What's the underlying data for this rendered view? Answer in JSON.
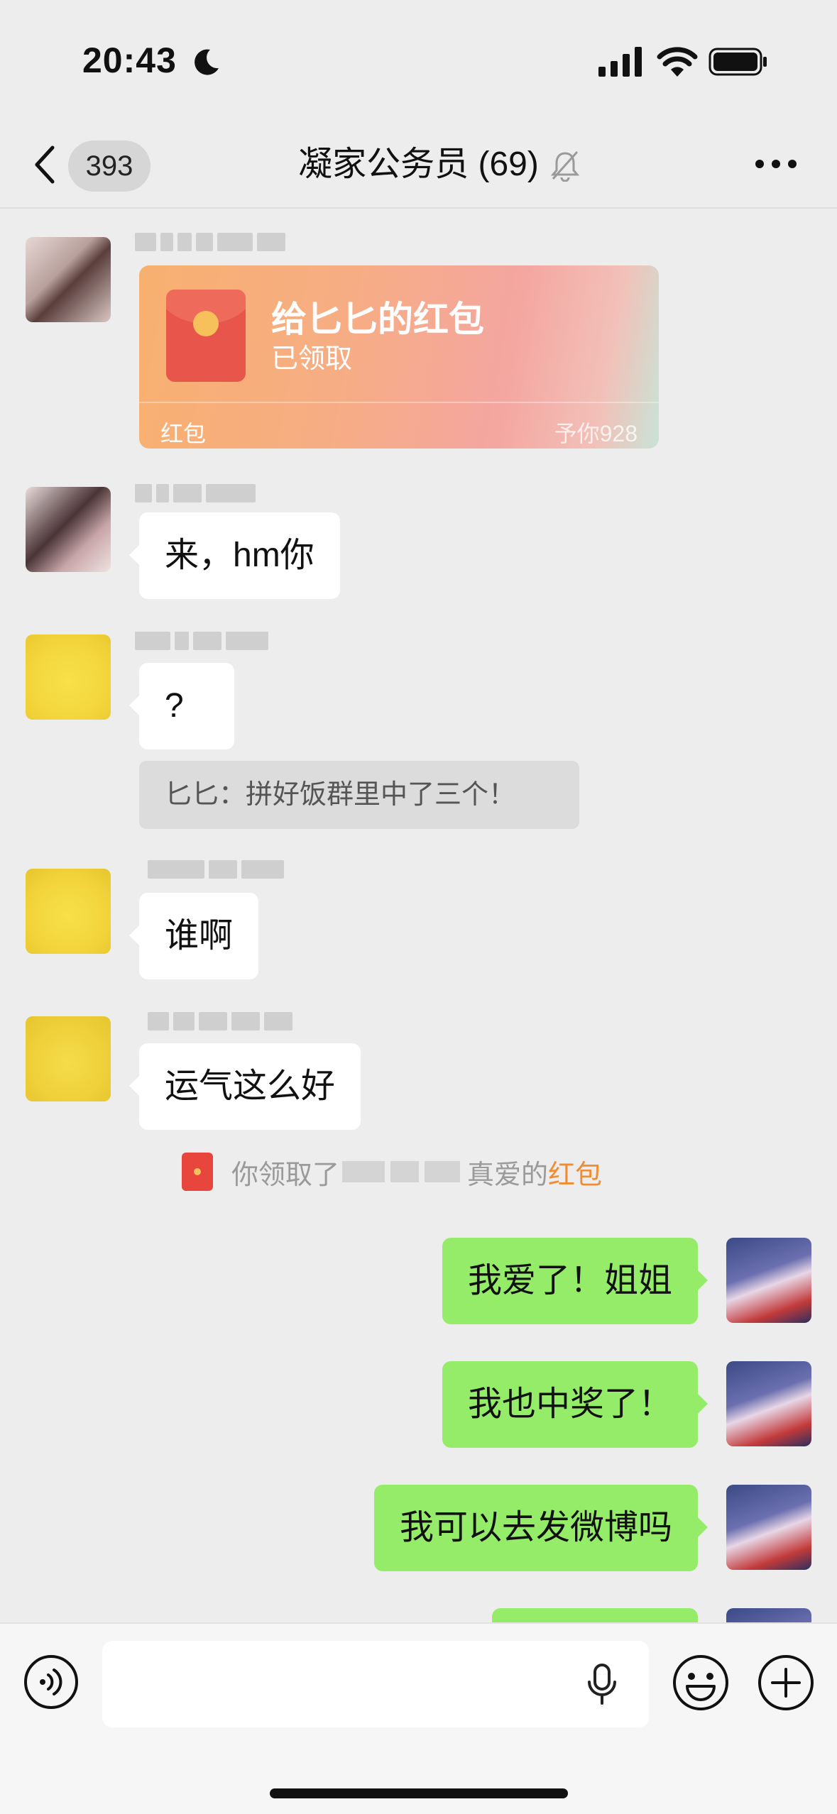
{
  "status": {
    "time": "20:43"
  },
  "nav": {
    "back_count": "393",
    "title": "凝家公务员 (69)"
  },
  "messages": {
    "red_packet": {
      "title": "给匕匕的红包",
      "status": "已领取",
      "label": "红包",
      "sender": "予你928"
    },
    "m1": "来，hm你",
    "m2": "?",
    "quote": "匕匕：拼好饭群里中了三个！",
    "m3": "谁啊",
    "m4": "运气这么好",
    "system": {
      "prefix": "你领取了",
      "middle": "真爱的",
      "link": "红包"
    },
    "me1": "我爱了！姐姐",
    "me2": "我也中奖了！",
    "me3": "我可以去发微博吗"
  },
  "colors": {
    "my_bubble": "#95ec69",
    "their_bubble": "#ffffff",
    "background": "#ededed",
    "red_packet_link": "#f08c33"
  },
  "icons": [
    "back-icon",
    "mute-bell-icon",
    "more-icon",
    "voice-icon",
    "microphone-icon",
    "emoji-icon",
    "plus-icon"
  ]
}
